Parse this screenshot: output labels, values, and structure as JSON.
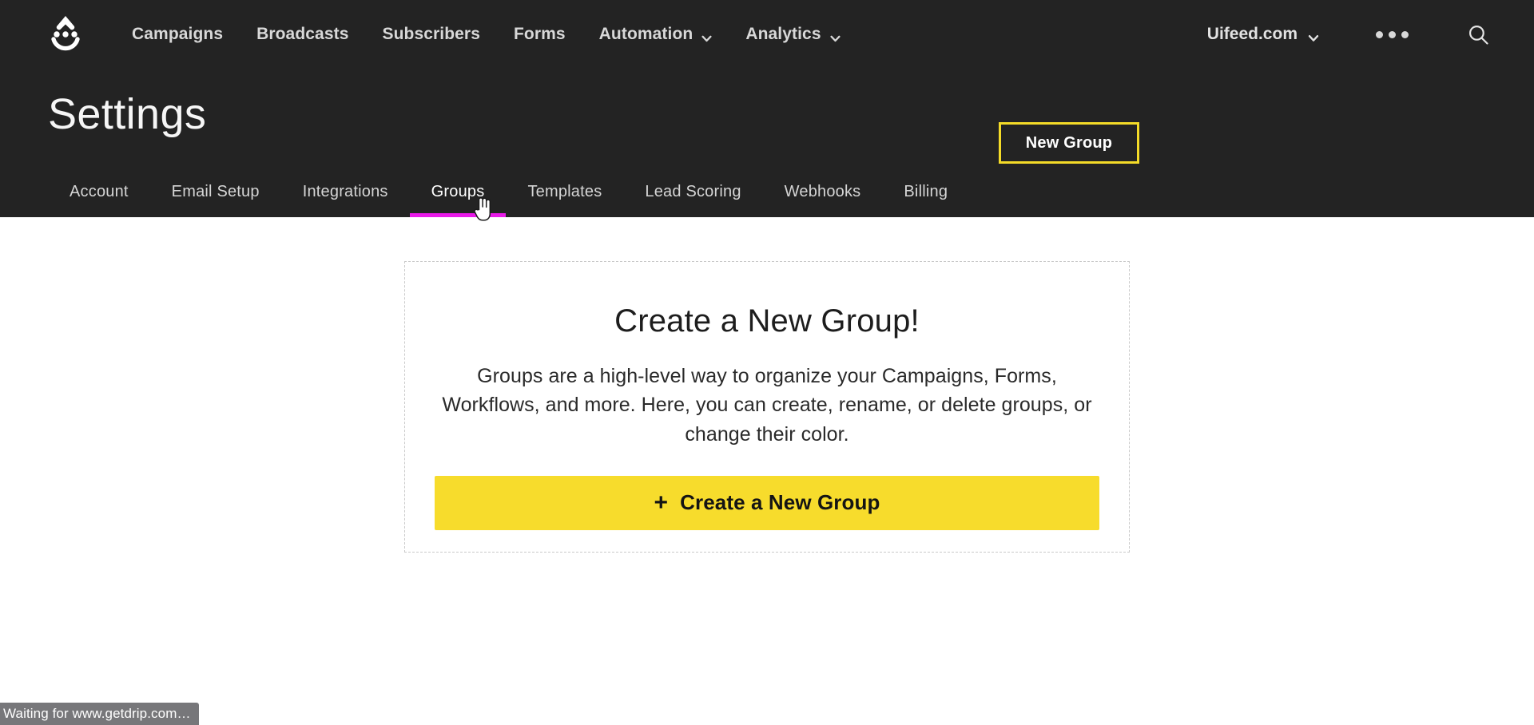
{
  "header": {
    "logo_icon": "drip-smiley-logo",
    "nav_items": [
      {
        "label": "Campaigns",
        "has_dropdown": false
      },
      {
        "label": "Broadcasts",
        "has_dropdown": false
      },
      {
        "label": "Subscribers",
        "has_dropdown": false
      },
      {
        "label": "Forms",
        "has_dropdown": false
      },
      {
        "label": "Automation",
        "has_dropdown": true
      },
      {
        "label": "Analytics",
        "has_dropdown": true
      }
    ],
    "account": {
      "label": "Uifeed.com",
      "chevron_icon": "chevron-down-icon"
    },
    "more_icon": "kebab-dots-icon",
    "search_icon": "search-icon",
    "background_color": "#232323"
  },
  "page": {
    "title": "Settings",
    "new_group_label": "New Group",
    "new_group_border_color": "#f4db28"
  },
  "tabs": {
    "active": "Groups",
    "active_underline_color": "#e81ae8",
    "items": [
      {
        "label": "Account"
      },
      {
        "label": "Email Setup"
      },
      {
        "label": "Integrations"
      },
      {
        "label": "Groups"
      },
      {
        "label": "Templates"
      },
      {
        "label": "Lead Scoring"
      },
      {
        "label": "Webhooks"
      },
      {
        "label": "Billing"
      }
    ]
  },
  "empty_state": {
    "title": "Create a New Group!",
    "description": "Groups are a high-level way to organize your Campaigns, Forms, Workflows, and more. Here, you can create, rename, or delete groups, or change their color.",
    "cta_plus": "+",
    "cta_label": "Create a New Group",
    "cta_color": "#f7dc2c"
  },
  "statusbar": {
    "text": "Waiting for www.getdrip.com…"
  },
  "cursor": {
    "icon": "pointer-hand-cursor"
  }
}
